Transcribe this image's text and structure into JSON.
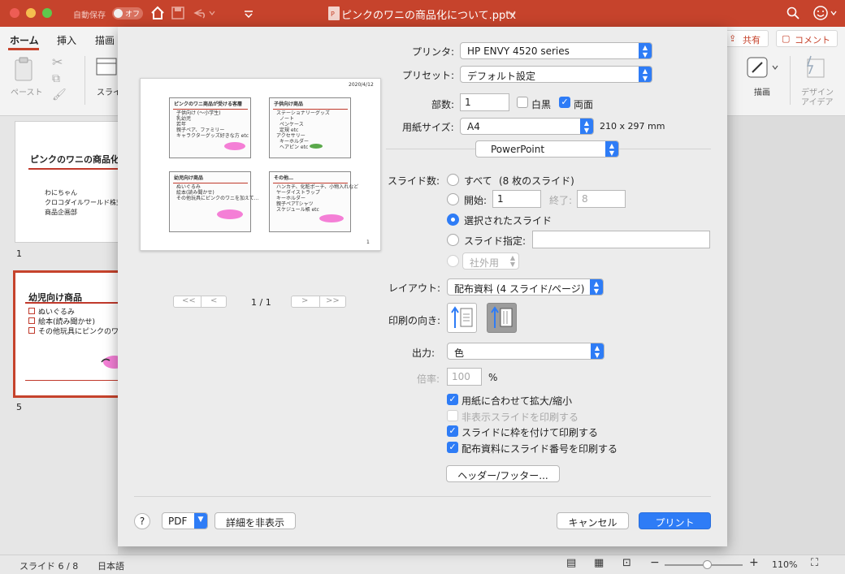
{
  "window": {
    "autosave_label": "自動保存",
    "autosave_state": "オフ",
    "title": "ピンクのワニの商品化について.pptx"
  },
  "ribbon": {
    "tabs": [
      "ホーム",
      "挿入",
      "描画"
    ],
    "share_label": "共有",
    "comment_label": "コメント",
    "paste_label": "ペースト",
    "slide_label": "スライ",
    "draw_label": "描画",
    "design_ideas_line1": "デザイン",
    "design_ideas_line2": "アイデア"
  },
  "slide_panel": {
    "slide1_title": "ピンクのワニの商品化に",
    "slide1_lines": [
      "わにちゃん",
      "クロコダイルワールド株式会",
      "商品企画部"
    ],
    "slide1_number": "1",
    "slide5_title": "幼児向け商品",
    "slide5_items": [
      "ぬいぐるみ",
      "絵本(読み聞かせ)",
      "その他玩具にピンクのワニを"
    ],
    "slide5_number": "5"
  },
  "preview": {
    "date": "2020/4/12",
    "page_number": "1",
    "slides": [
      {
        "title": "ピンクのワニ商品が受ける客層",
        "lines": [
          "子供向け (〜小学生)",
          "乳幼児",
          "若年",
          "親子ペア、ファミリー",
          "キャラクターグッズ好きな方 etc"
        ]
      },
      {
        "title": "子供向け商品",
        "lines": [
          "ステーショナリーグッズ",
          "ノート",
          "ペンケース",
          "定規 etc",
          "アクセサリー",
          "キーホルダー",
          "ヘアピン etc"
        ]
      },
      {
        "title": "幼児向け商品",
        "lines": [
          "ぬいぐるみ",
          "絵本(読み聞かせ)",
          "その他玩具にピンクのワニを加えて..."
        ]
      },
      {
        "title": "その他…",
        "lines": [
          "ハンカチ、化粧ポーチ、小物入れなど",
          "ヤーダイストラップ",
          "キーホルダー",
          "親子ペアTシャツ",
          "スケジュール帳 etc"
        ]
      }
    ],
    "page_indicator": "1 / 1",
    "first_btn": "<<",
    "prev_btn": "<",
    "next_btn": ">",
    "last_btn": ">>"
  },
  "print": {
    "printer_label": "プリンタ:",
    "printer_value": "HP ENVY 4520 series",
    "preset_label": "プリセット:",
    "preset_value": "デフォルト設定",
    "copies_label": "部数:",
    "copies_value": "1",
    "bw_label": "白黒",
    "bw_checked": false,
    "duplex_label": "両面",
    "duplex_checked": true,
    "paper_label": "用紙サイズ:",
    "paper_value": "A4",
    "paper_dims": "210 x 297 mm",
    "app_section": "PowerPoint",
    "slides_label": "スライド数:",
    "all_label": "すべて",
    "all_count": "(8 枚のスライド)",
    "from_label": "開始:",
    "from_value": "1",
    "to_label": "終了:",
    "to_value": "8",
    "selected_label": "選択されたスライド",
    "custom_label": "スライド指定:",
    "custom_value": "",
    "classification_value": "社外用",
    "layout_label": "レイアウト:",
    "layout_value": "配布資料 (4 スライド/ページ)",
    "orientation_label": "印刷の向き:",
    "output_label": "出力:",
    "output_value": "色",
    "scale_label": "倍率:",
    "scale_value": "100",
    "scale_unit": "%",
    "options": [
      {
        "label": "用紙に合わせて拡大/縮小",
        "checked": true,
        "enabled": true
      },
      {
        "label": "非表示スライドを印刷する",
        "checked": false,
        "enabled": false
      },
      {
        "label": "スライドに枠を付けて印刷する",
        "checked": true,
        "enabled": true
      },
      {
        "label": "配布資料にスライド番号を印刷する",
        "checked": true,
        "enabled": true
      }
    ],
    "header_footer_btn": "ヘッダー/フッター...",
    "help_btn": "?",
    "pdf_btn": "PDF",
    "hide_details_btn": "詳細を非表示",
    "cancel_btn": "キャンセル",
    "print_btn": "プリント"
  },
  "status": {
    "slide_info": "スライド 6 / 8",
    "language": "日本語",
    "zoom": "110%"
  },
  "colors": {
    "accent": "#2e7cf6",
    "titlebar": "#c6432c",
    "slide_accent": "#c0392b"
  }
}
